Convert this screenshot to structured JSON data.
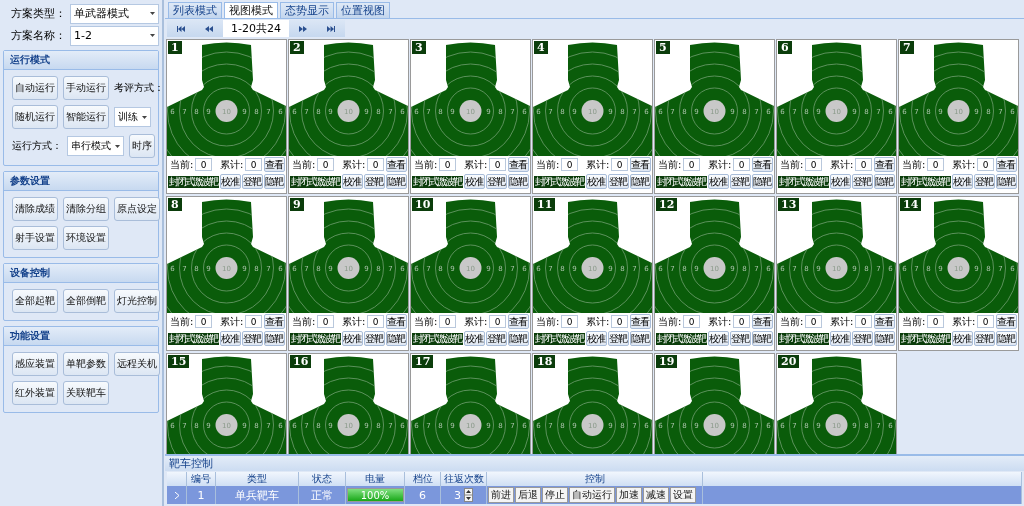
{
  "left_panel": {
    "fields": [
      {
        "label": "方案类型：",
        "value": "单武器模式"
      },
      {
        "label": "方案名称：",
        "value": "1-2"
      }
    ],
    "groups": [
      {
        "title": "运行模式",
        "rows": [
          [
            {
              "kind": "button",
              "text": "自动运行"
            },
            {
              "kind": "button",
              "text": "手动运行"
            },
            {
              "kind": "label",
              "text": "考评方式："
            }
          ],
          [
            {
              "kind": "button",
              "text": "随机运行"
            },
            {
              "kind": "button",
              "text": "智能运行"
            },
            {
              "kind": "select",
              "text": "训练"
            }
          ],
          [
            {
              "kind": "label",
              "text": "运行方式："
            },
            {
              "kind": "select",
              "text": "串行模式"
            },
            {
              "kind": "button",
              "text": "时序"
            }
          ]
        ]
      },
      {
        "title": "参数设置",
        "rows": [
          [
            {
              "kind": "button",
              "text": "清除成绩"
            },
            {
              "kind": "button",
              "text": "清除分组"
            },
            {
              "kind": "button",
              "text": "原点设定"
            }
          ],
          [
            {
              "kind": "button",
              "text": "射手设置"
            },
            {
              "kind": "button",
              "text": "环境设置"
            }
          ]
        ]
      },
      {
        "title": "设备控制",
        "rows": [
          [
            {
              "kind": "button",
              "text": "全部起靶"
            },
            {
              "kind": "button",
              "text": "全部倒靶"
            },
            {
              "kind": "button",
              "text": "灯光控制"
            }
          ]
        ]
      },
      {
        "title": "功能设置",
        "rows": [
          [
            {
              "kind": "button",
              "text": "感应装置"
            },
            {
              "kind": "button",
              "text": "单靶参数"
            },
            {
              "kind": "button",
              "text": "远程关机"
            }
          ],
          [
            {
              "kind": "button",
              "text": "红外装置"
            },
            {
              "kind": "button",
              "text": "关联靶车"
            }
          ]
        ]
      }
    ]
  },
  "tabs": [
    {
      "label": "列表模式",
      "selected": false
    },
    {
      "label": "视图模式",
      "selected": true
    },
    {
      "label": "态势显示",
      "selected": false
    },
    {
      "label": "位置视图",
      "selected": false
    }
  ],
  "pager": {
    "range": "1-20共24"
  },
  "targets": [
    {
      "number": "1",
      "rings": [
        "6",
        "7",
        "8",
        "9",
        "10",
        "9",
        "8",
        "7",
        "6"
      ],
      "current_label": "当前:",
      "current": "0",
      "total_label": "累计:",
      "total": "0",
      "view": "查看",
      "type": "封闭式激波靶",
      "buttons": [
        "校准",
        "登靶",
        "隐靶"
      ]
    },
    {
      "number": "2",
      "rings": [
        "6",
        "7",
        "8",
        "9",
        "10",
        "9",
        "8",
        "7",
        "6"
      ],
      "current_label": "当前:",
      "current": "0",
      "total_label": "累计:",
      "total": "0",
      "view": "查看",
      "type": "封闭式激波靶",
      "buttons": [
        "校准",
        "登靶",
        "隐靶"
      ]
    },
    {
      "number": "3",
      "rings": [
        "6",
        "7",
        "8",
        "9",
        "10",
        "9",
        "8",
        "7",
        "6"
      ],
      "current_label": "当前:",
      "current": "0",
      "total_label": "累计:",
      "total": "0",
      "view": "查看",
      "type": "封闭式激波靶",
      "buttons": [
        "校准",
        "登靶",
        "隐靶"
      ]
    },
    {
      "number": "4",
      "rings": [
        "6",
        "7",
        "8",
        "9",
        "10",
        "9",
        "8",
        "7",
        "6"
      ],
      "current_label": "当前:",
      "current": "0",
      "total_label": "累计:",
      "total": "0",
      "view": "查看",
      "type": "封闭式激波靶",
      "buttons": [
        "校准",
        "登靶",
        "隐靶"
      ]
    },
    {
      "number": "5",
      "rings": [
        "6",
        "7",
        "8",
        "9",
        "10",
        "9",
        "8",
        "7",
        "6"
      ],
      "current_label": "当前:",
      "current": "0",
      "total_label": "累计:",
      "total": "0",
      "view": "查看",
      "type": "封闭式激波靶",
      "buttons": [
        "校准",
        "登靶",
        "隐靶"
      ]
    },
    {
      "number": "6",
      "rings": [
        "6",
        "7",
        "8",
        "9",
        "10",
        "9",
        "8",
        "7",
        "6"
      ],
      "current_label": "当前:",
      "current": "0",
      "total_label": "累计:",
      "total": "0",
      "view": "查看",
      "type": "封闭式激波靶",
      "buttons": [
        "校准",
        "登靶",
        "隐靶"
      ]
    },
    {
      "number": "7",
      "rings": [
        "6",
        "7",
        "8",
        "9",
        "10",
        "9",
        "8",
        "7",
        "6"
      ],
      "current_label": "当前:",
      "current": "0",
      "total_label": "累计:",
      "total": "0",
      "view": "查看",
      "type": "封闭式激波靶",
      "buttons": [
        "校准",
        "登靶",
        "隐靶"
      ]
    },
    {
      "number": "8",
      "rings": [
        "6",
        "7",
        "8",
        "9",
        "10",
        "9",
        "8",
        "7",
        "6"
      ],
      "current_label": "当前:",
      "current": "0",
      "total_label": "累计:",
      "total": "0",
      "view": "查看",
      "type": "封闭式激波靶",
      "buttons": [
        "校准",
        "登靶",
        "隐靶"
      ]
    },
    {
      "number": "9",
      "rings": [
        "6",
        "7",
        "8",
        "9",
        "10",
        "9",
        "8",
        "7",
        "6"
      ],
      "current_label": "当前:",
      "current": "0",
      "total_label": "累计:",
      "total": "0",
      "view": "查看",
      "type": "封闭式激波靶",
      "buttons": [
        "校准",
        "登靶",
        "隐靶"
      ]
    },
    {
      "number": "10",
      "rings": [
        "6",
        "7",
        "8",
        "9",
        "10",
        "9",
        "8",
        "7",
        "6"
      ],
      "current_label": "当前:",
      "current": "0",
      "total_label": "累计:",
      "total": "0",
      "view": "查看",
      "type": "封闭式激波靶",
      "buttons": [
        "校准",
        "登靶",
        "隐靶"
      ]
    },
    {
      "number": "11",
      "rings": [
        "6",
        "7",
        "8",
        "9",
        "10",
        "9",
        "8",
        "7",
        "6"
      ],
      "current_label": "当前:",
      "current": "0",
      "total_label": "累计:",
      "total": "0",
      "view": "查看",
      "type": "封闭式激波靶",
      "buttons": [
        "校准",
        "登靶",
        "隐靶"
      ]
    },
    {
      "number": "12",
      "rings": [
        "6",
        "7",
        "8",
        "9",
        "10",
        "9",
        "8",
        "7",
        "6"
      ],
      "current_label": "当前:",
      "current": "0",
      "total_label": "累计:",
      "total": "0",
      "view": "查看",
      "type": "封闭式激波靶",
      "buttons": [
        "校准",
        "登靶",
        "隐靶"
      ]
    },
    {
      "number": "13",
      "rings": [
        "6",
        "7",
        "8",
        "9",
        "10",
        "9",
        "8",
        "7",
        "6"
      ],
      "current_label": "当前:",
      "current": "0",
      "total_label": "累计:",
      "total": "0",
      "view": "查看",
      "type": "封闭式激波靶",
      "buttons": [
        "校准",
        "登靶",
        "隐靶"
      ]
    },
    {
      "number": "14",
      "rings": [
        "6",
        "7",
        "8",
        "9",
        "10",
        "9",
        "8",
        "7",
        "6"
      ],
      "current_label": "当前:",
      "current": "0",
      "total_label": "累计:",
      "total": "0",
      "view": "查看",
      "type": "封闭式激波靶",
      "buttons": [
        "校准",
        "登靶",
        "隐靶"
      ]
    },
    {
      "number": "15",
      "rings": [
        "6",
        "7",
        "8",
        "9",
        "10",
        "9",
        "8",
        "7",
        "6"
      ]
    },
    {
      "number": "16",
      "rings": [
        "6",
        "7",
        "8",
        "9",
        "10",
        "9",
        "8",
        "7",
        "6"
      ]
    },
    {
      "number": "17",
      "rings": [
        "6",
        "7",
        "8",
        "9",
        "10",
        "9",
        "8",
        "7",
        "6"
      ]
    },
    {
      "number": "18",
      "rings": [
        "6",
        "7",
        "8",
        "9",
        "10",
        "9",
        "8",
        "7",
        "6"
      ]
    },
    {
      "number": "19",
      "rings": [
        "6",
        "7",
        "8",
        "9",
        "10",
        "9",
        "8",
        "7",
        "6"
      ]
    },
    {
      "number": "20",
      "rings": [
        "6",
        "7",
        "8",
        "9",
        "10",
        "9",
        "8",
        "7",
        "6"
      ]
    }
  ],
  "vehicle_control": {
    "title": "靶车控制",
    "columns": [
      "编号",
      "类型",
      "状态",
      "电量",
      "档位",
      "往返次数",
      "控制"
    ],
    "rows": [
      {
        "selected": true,
        "number": "1",
        "type": "单兵靶车",
        "status": "正常",
        "level": 1,
        "battery": "100%",
        "gear": "6",
        "trips": "3",
        "controls": [
          "前进",
          "后退",
          "停止",
          "自动运行",
          "加速",
          "减速",
          "设置"
        ]
      }
    ]
  }
}
